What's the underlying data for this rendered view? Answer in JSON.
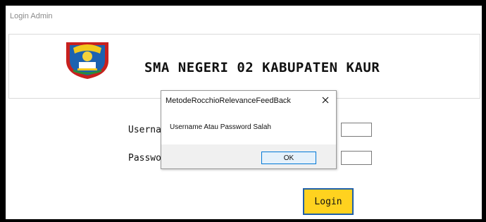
{
  "window": {
    "title": "Login Admin"
  },
  "header": {
    "school_name": "SMA NEGERI 02 KABUPATEN KAUR"
  },
  "form": {
    "username_label": "Usernam",
    "password_label": "Passwo",
    "username_value": "",
    "password_value": "",
    "login_label": "Login"
  },
  "dialog": {
    "title": "MetodeRocchioRelevanceFeedBack",
    "close_glyph": "✕",
    "message": "Username Atau Password Salah",
    "ok_label": "OK"
  },
  "colors": {
    "login_button_fill": "#ffd21f",
    "login_button_border": "#1f5fa8",
    "ok_button_border": "#0078d7"
  },
  "icons": {
    "logo": "school-crest-logo",
    "close": "close-icon"
  }
}
